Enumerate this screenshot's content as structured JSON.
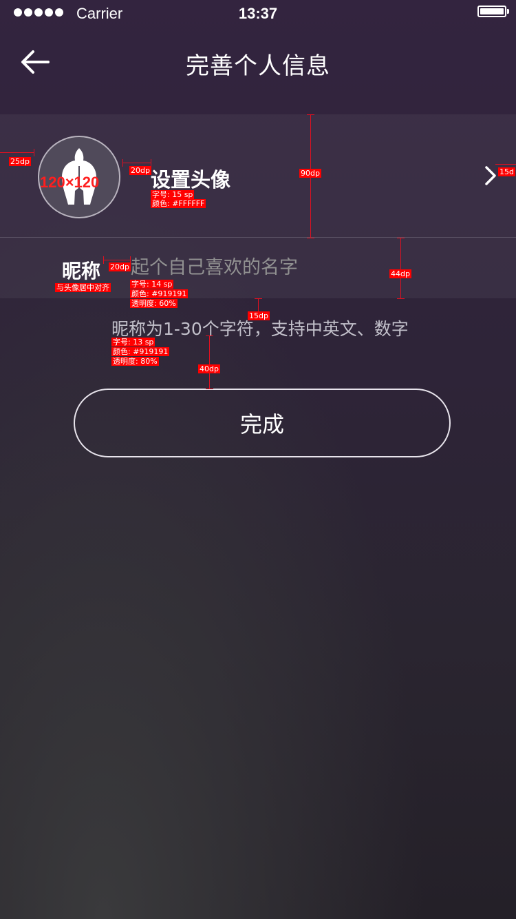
{
  "status_bar": {
    "carrier": "Carrier",
    "time": "13:37",
    "signal_dots": 5
  },
  "header": {
    "title": "完善个人信息",
    "back_icon": "back-arrow-icon"
  },
  "avatar_row": {
    "label": "设置头像",
    "avatar_icon": "spartan-helmet-icon",
    "chevron_icon": "chevron-right-icon"
  },
  "nickname_row": {
    "label": "昵称",
    "placeholder": "起个自己喜欢的名字",
    "value": ""
  },
  "hint": "昵称为1-30个字符，支持中英文、数字",
  "done_button": {
    "label": "完成"
  },
  "annotations": {
    "margin_25": "25dp",
    "avatar_gap": "20dp",
    "row_height_90": "90dp",
    "right_margin": "15d",
    "avatar_size": "120×120",
    "label_spec_size": "字号: 15 sp",
    "label_spec_color": "颜色: #FFFFFF",
    "nick_gap": "20dp",
    "row_height_44": "44dp",
    "nick_note": "与头像居中对齐",
    "input_spec_size": "字号: 14 sp",
    "input_spec_color": "颜色: #919191",
    "input_spec_alpha": "透明度: 60%",
    "hint_gap": "15dp",
    "hint_spec_size": "字号: 13 sp",
    "hint_spec_color": "颜色: #919191",
    "hint_spec_alpha": "透明度: 80%",
    "button_gap": "40dp"
  },
  "colors": {
    "annotation": "#ff0000",
    "text_primary": "#ffffff",
    "placeholder": "#919191"
  }
}
